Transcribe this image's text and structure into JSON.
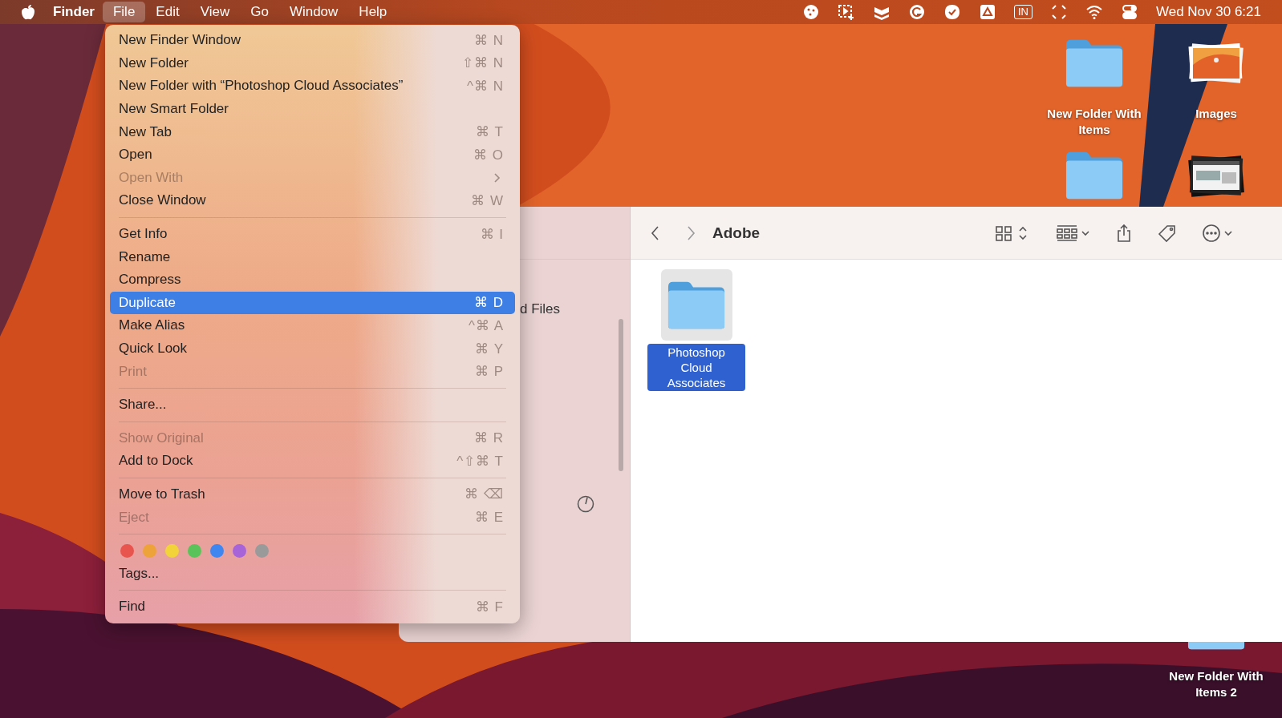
{
  "menubar": {
    "app": "Finder",
    "menus": [
      {
        "label": "File",
        "selected": true
      },
      {
        "label": "Edit",
        "selected": false
      },
      {
        "label": "View",
        "selected": false
      },
      {
        "label": "Go",
        "selected": false
      },
      {
        "label": "Window",
        "selected": false
      },
      {
        "label": "Help",
        "selected": false
      }
    ],
    "input_source": "IN",
    "clock": "Wed Nov 30  6:21"
  },
  "file_menu": {
    "items": [
      {
        "kind": "item",
        "label": "New Finder Window",
        "shortcut": "⌘ N",
        "disabled": false,
        "selected": false
      },
      {
        "kind": "item",
        "label": "New Folder",
        "shortcut": "⇧⌘ N",
        "disabled": false,
        "selected": false
      },
      {
        "kind": "item",
        "label": "New Folder with “Photoshop Cloud Associates”",
        "shortcut": "^⌘ N",
        "disabled": false,
        "selected": false
      },
      {
        "kind": "item",
        "label": "New Smart Folder",
        "disabled": false,
        "selected": false
      },
      {
        "kind": "item",
        "label": "New Tab",
        "shortcut": "⌘ T",
        "disabled": false,
        "selected": false
      },
      {
        "kind": "item",
        "label": "Open",
        "shortcut": "⌘ O",
        "disabled": false,
        "selected": false
      },
      {
        "kind": "item",
        "label": "Open With",
        "submenu": true,
        "disabled": true,
        "selected": false
      },
      {
        "kind": "item",
        "label": "Close Window",
        "shortcut": "⌘ W",
        "disabled": false,
        "selected": false
      },
      {
        "kind": "separator"
      },
      {
        "kind": "item",
        "label": "Get Info",
        "shortcut": "⌘ I",
        "disabled": false,
        "selected": false
      },
      {
        "kind": "item",
        "label": "Rename",
        "disabled": false,
        "selected": false
      },
      {
        "kind": "item",
        "label": "Compress",
        "disabled": false,
        "selected": false
      },
      {
        "kind": "item",
        "label": "Duplicate",
        "shortcut": "⌘ D",
        "disabled": false,
        "selected": true
      },
      {
        "kind": "item",
        "label": "Make Alias",
        "shortcut": "^⌘ A",
        "disabled": false,
        "selected": false
      },
      {
        "kind": "item",
        "label": "Quick Look",
        "shortcut": "⌘ Y",
        "disabled": false,
        "selected": false
      },
      {
        "kind": "item",
        "label": "Print",
        "shortcut": "⌘ P",
        "disabled": true,
        "selected": false
      },
      {
        "kind": "separator"
      },
      {
        "kind": "item",
        "label": "Share...",
        "disabled": false,
        "selected": false
      },
      {
        "kind": "separator"
      },
      {
        "kind": "item",
        "label": "Show Original",
        "shortcut": "⌘ R",
        "disabled": true,
        "selected": false
      },
      {
        "kind": "item",
        "label": "Add to Dock",
        "shortcut": "^⇧⌘ T",
        "disabled": false,
        "selected": false
      },
      {
        "kind": "separator"
      },
      {
        "kind": "item",
        "label": "Move to Trash",
        "shortcut": "⌘ ⌫",
        "disabled": false,
        "selected": false
      },
      {
        "kind": "item",
        "label": "Eject",
        "shortcut": "⌘ E",
        "disabled": true,
        "selected": false
      },
      {
        "kind": "separator"
      },
      {
        "kind": "tags",
        "colors": [
          {
            "color": "#e8554e"
          },
          {
            "color": "#eea23a"
          },
          {
            "color": "#f2d43a"
          },
          {
            "color": "#5ac35a"
          },
          {
            "color": "#3f86f0"
          },
          {
            "color": "#a763d8"
          },
          {
            "color": "#9a9a9a"
          }
        ]
      },
      {
        "kind": "item",
        "label": "Tags...",
        "disabled": false,
        "selected": false
      },
      {
        "kind": "separator"
      },
      {
        "kind": "item",
        "label": "Find",
        "shortcut": "⌘ F",
        "disabled": false,
        "selected": false
      }
    ]
  },
  "finder": {
    "sidebar_text": "d Files",
    "title": "Adobe",
    "items": [
      {
        "label": "Photoshop Cloud Associates",
        "selected": true
      }
    ]
  },
  "desktop_icons": [
    {
      "kind": "folder",
      "label": "New Folder With Items"
    },
    {
      "kind": "images",
      "label": "Images"
    },
    {
      "kind": "folder"
    },
    {
      "kind": "screenshots"
    },
    {
      "kind": "folder",
      "label": "New Folder With Items 2"
    }
  ]
}
